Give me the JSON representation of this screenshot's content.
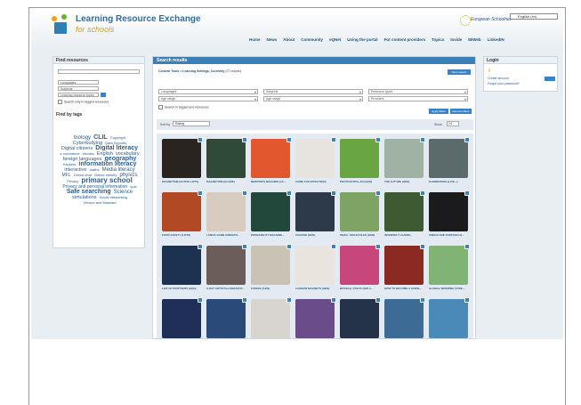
{
  "header": {
    "title": "Learning Resource Exchange",
    "subtitle": "for schools",
    "eu_logo_text": "European Schoolnet",
    "language": "English (en)"
  },
  "nav": [
    "Home",
    "News",
    "About",
    "Community",
    "eQNet",
    "Using the portal",
    "For content providers",
    "Topics",
    "Inside",
    "MiWeb",
    "LinkedIN"
  ],
  "find_panel": {
    "title": "Find resources",
    "selects": [
      "Languages",
      "Subjects",
      "Learning resource types"
    ],
    "checkbox_label": "Search only in tagged resources",
    "tags_title": "Find by tags",
    "tags": [
      {
        "text": "biology",
        "size": 6
      },
      {
        "text": "CLIL",
        "size": 7
      },
      {
        "text": "Copyright",
        "size": 4
      },
      {
        "text": "Cyberbullying",
        "size": 5.5
      },
      {
        "text": "Data Security",
        "size": 4
      },
      {
        "text": "Digital citizens",
        "size": 5.5
      },
      {
        "text": "Digital literacy",
        "size": 7
      },
      {
        "text": "e-commerce",
        "size": 4
      },
      {
        "text": "ebooks",
        "size": 4
      },
      {
        "text": "English",
        "size": 5.5
      },
      {
        "text": "vocabulary",
        "size": 5.5
      },
      {
        "text": "foreign languages",
        "size": 5.5
      },
      {
        "text": "geography",
        "size": 7
      },
      {
        "text": "Hackers",
        "size": 4
      },
      {
        "text": "information literacy",
        "size": 7
      },
      {
        "text": "interactive",
        "size": 5.5
      },
      {
        "text": "maths",
        "size": 4
      },
      {
        "text": "Media literacy",
        "size": 6
      },
      {
        "text": "MFL",
        "size": 5
      },
      {
        "text": "Online chat",
        "size": 4
      },
      {
        "text": "Online identity",
        "size": 4
      },
      {
        "text": "physics",
        "size": 6
      },
      {
        "text": "Privacy",
        "size": 4
      },
      {
        "text": "primary school",
        "size": 8
      },
      {
        "text": "Privacy and personal information",
        "size": 5
      },
      {
        "text": "quiz",
        "size": 4
      },
      {
        "text": "Safe searching",
        "size": 7
      },
      {
        "text": "Science",
        "size": 6
      },
      {
        "text": "simulations",
        "size": 5.5
      },
      {
        "text": "Social networking",
        "size": 4
      },
      {
        "text": "Viruses and Malware",
        "size": 4
      }
    ]
  },
  "results": {
    "title": "Search results",
    "query_line": "Content Tools > Learning Settings, Currently",
    "count_text": "(27 results)",
    "save_label": "Save search",
    "filters": [
      "Languages",
      "Subjects",
      "Resource types",
      "Age range",
      "Age range",
      "Providers"
    ],
    "checkbox_label": "Search in tagged and resources",
    "apply_label": "Apply filters",
    "remove_label": "Remove filters",
    "sort_label": "Sort by",
    "sort_value": "Rating",
    "perpage_label": "Show",
    "perpage_value": "24",
    "cards": [
      {
        "label": "MAGNETISM (ACTIVE LOTS)",
        "color": "#2a2420"
      },
      {
        "label": "MAGNETISM (GLOBE)",
        "color": "#2f4a36"
      },
      {
        "label": "NEWTON'S MACHINE (LE...",
        "color": "#e3572e"
      },
      {
        "label": "COME THE EFFECT(EN)",
        "color": "#e7e3df"
      },
      {
        "label": "PHOTOSYNTH. AN (GEN)",
        "color": "#6aa543"
      },
      {
        "label": "THE FUTURE (GEN)",
        "color": "#a0b2a4"
      },
      {
        "label": "ELEMENTARE (LIVE...)",
        "color": "#5b6a6b"
      },
      {
        "label": "FOOD SAFETY (LOTS)",
        "color": "#b14a24"
      },
      {
        "label": "LUNGS GAME ANIMATO...",
        "color": "#d8ccc0"
      },
      {
        "label": "PROBABILITY MACHINE...",
        "color": "#22483c"
      },
      {
        "label": "CHOOSE (GEN)",
        "color": "#2c3a49"
      },
      {
        "label": "SMALL MOLECULES (GEN)",
        "color": "#7da464"
      },
      {
        "label": "INVERSELY LEARNI...",
        "color": "#3e5a32"
      },
      {
        "label": "SINGOLARE PARTICELLE...",
        "color": "#1b1a1c"
      },
      {
        "label": "LIFE OF ROOTEERS (GEN)",
        "color": "#1d3250"
      },
      {
        "label": "X-RAY CRYSTALLOGRAPHY...",
        "color": "#6b5e5a"
      },
      {
        "label": "CODICE (GEN)",
        "color": "#c9c3b6"
      },
      {
        "label": "CARBON MAGNETS (GEN)",
        "color": "#eae4de"
      },
      {
        "label": "BOOKLE, STACK AND C...",
        "color": "#c8477a"
      },
      {
        "label": "HOW TO BECOME A SCIEN...",
        "color": "#8a2a22"
      },
      {
        "label": "GLOBAL WARMING CORE...",
        "color": "#7fb474"
      },
      {
        "label": "",
        "color": "#1f2f58"
      },
      {
        "label": "",
        "color": "#2a4a7a"
      },
      {
        "label": "",
        "color": "#d8d4d0"
      },
      {
        "label": "",
        "color": "#6a4c8a"
      },
      {
        "label": "",
        "color": "#24324a"
      },
      {
        "label": "",
        "color": "#3c6c96"
      },
      {
        "label": "",
        "color": "#4a8ab8"
      }
    ]
  },
  "login": {
    "title": "Login",
    "create_label": "Create account",
    "forgot_label": "Forgot your password?"
  }
}
